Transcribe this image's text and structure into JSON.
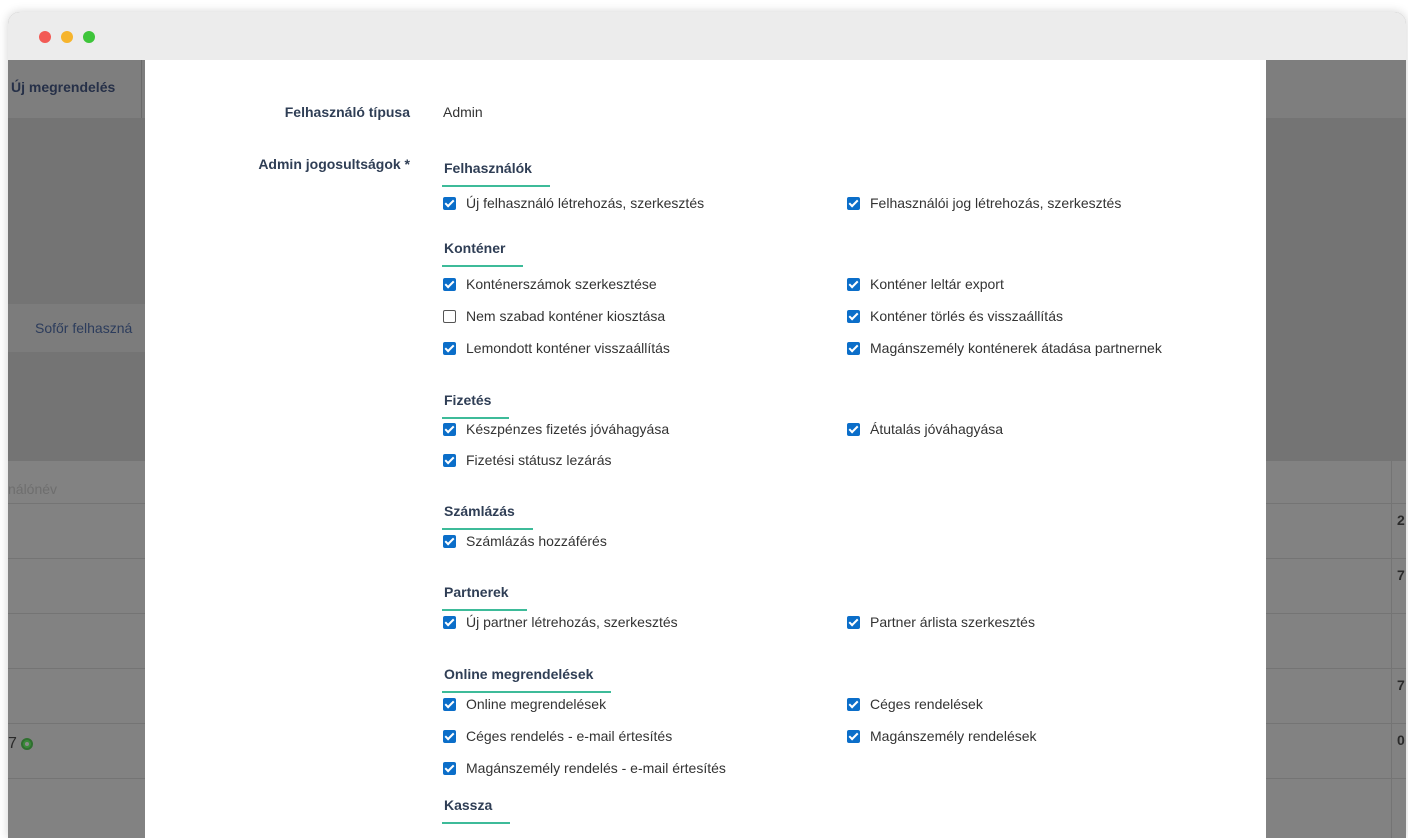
{
  "window": {
    "controls": [
      "close",
      "minimize",
      "maximize"
    ]
  },
  "background": {
    "nav_item": "Új megrendelés",
    "card_label": "Sofőr felhaszná",
    "table_header": "nálónév",
    "row_id": "7",
    "right_cells": [
      "2",
      "7",
      "7",
      "0"
    ]
  },
  "modal": {
    "user_type_label": "Felhasználó típusa",
    "user_type_value": "Admin",
    "permissions_label": "Admin jogosultságok *",
    "sections": [
      {
        "title": "Felhasználók",
        "items": [
          {
            "label": "Új felhasználó létrehozás, szerkesztés",
            "checked": true
          },
          {
            "label": "Felhasználói jog létrehozás, szerkesztés",
            "checked": true
          }
        ]
      },
      {
        "title": "Konténer",
        "items": [
          {
            "label": "Konténerszámok szerkesztése",
            "checked": true
          },
          {
            "label": "Konténer leltár export",
            "checked": true
          },
          {
            "label": "Nem szabad konténer kiosztása",
            "checked": false
          },
          {
            "label": "Konténer törlés és visszaállítás",
            "checked": true
          },
          {
            "label": "Lemondott konténer visszaállítás",
            "checked": true
          },
          {
            "label": "Magánszemély konténerek átadása partnernek",
            "checked": true
          }
        ]
      },
      {
        "title": "Fizetés",
        "items": [
          {
            "label": "Készpénzes fizetés jóváhagyása",
            "checked": true
          },
          {
            "label": "Átutalás jóváhagyása",
            "checked": true
          },
          {
            "label": "Fizetési státusz lezárás",
            "checked": true
          }
        ]
      },
      {
        "title": "Számlázás",
        "items": [
          {
            "label": "Számlázás hozzáférés",
            "checked": true
          }
        ]
      },
      {
        "title": "Partnerek",
        "items": [
          {
            "label": "Új partner létrehozás, szerkesztés",
            "checked": true
          },
          {
            "label": "Partner árlista szerkesztés",
            "checked": true
          }
        ]
      },
      {
        "title": "Online megrendelések",
        "items": [
          {
            "label": "Online megrendelések",
            "checked": true
          },
          {
            "label": "Céges rendelések",
            "checked": true
          },
          {
            "label": "Céges rendelés - e-mail értesítés",
            "checked": true
          },
          {
            "label": "Magánszemély rendelések",
            "checked": true
          },
          {
            "label": "Magánszemély rendelés - e-mail értesítés",
            "checked": true
          }
        ]
      },
      {
        "title": "Kassza",
        "items": []
      }
    ]
  },
  "colors": {
    "accent_underline": "#3dbb99",
    "checkbox_blue": "#0b6ec9",
    "label_navy": "#2f3e55"
  }
}
